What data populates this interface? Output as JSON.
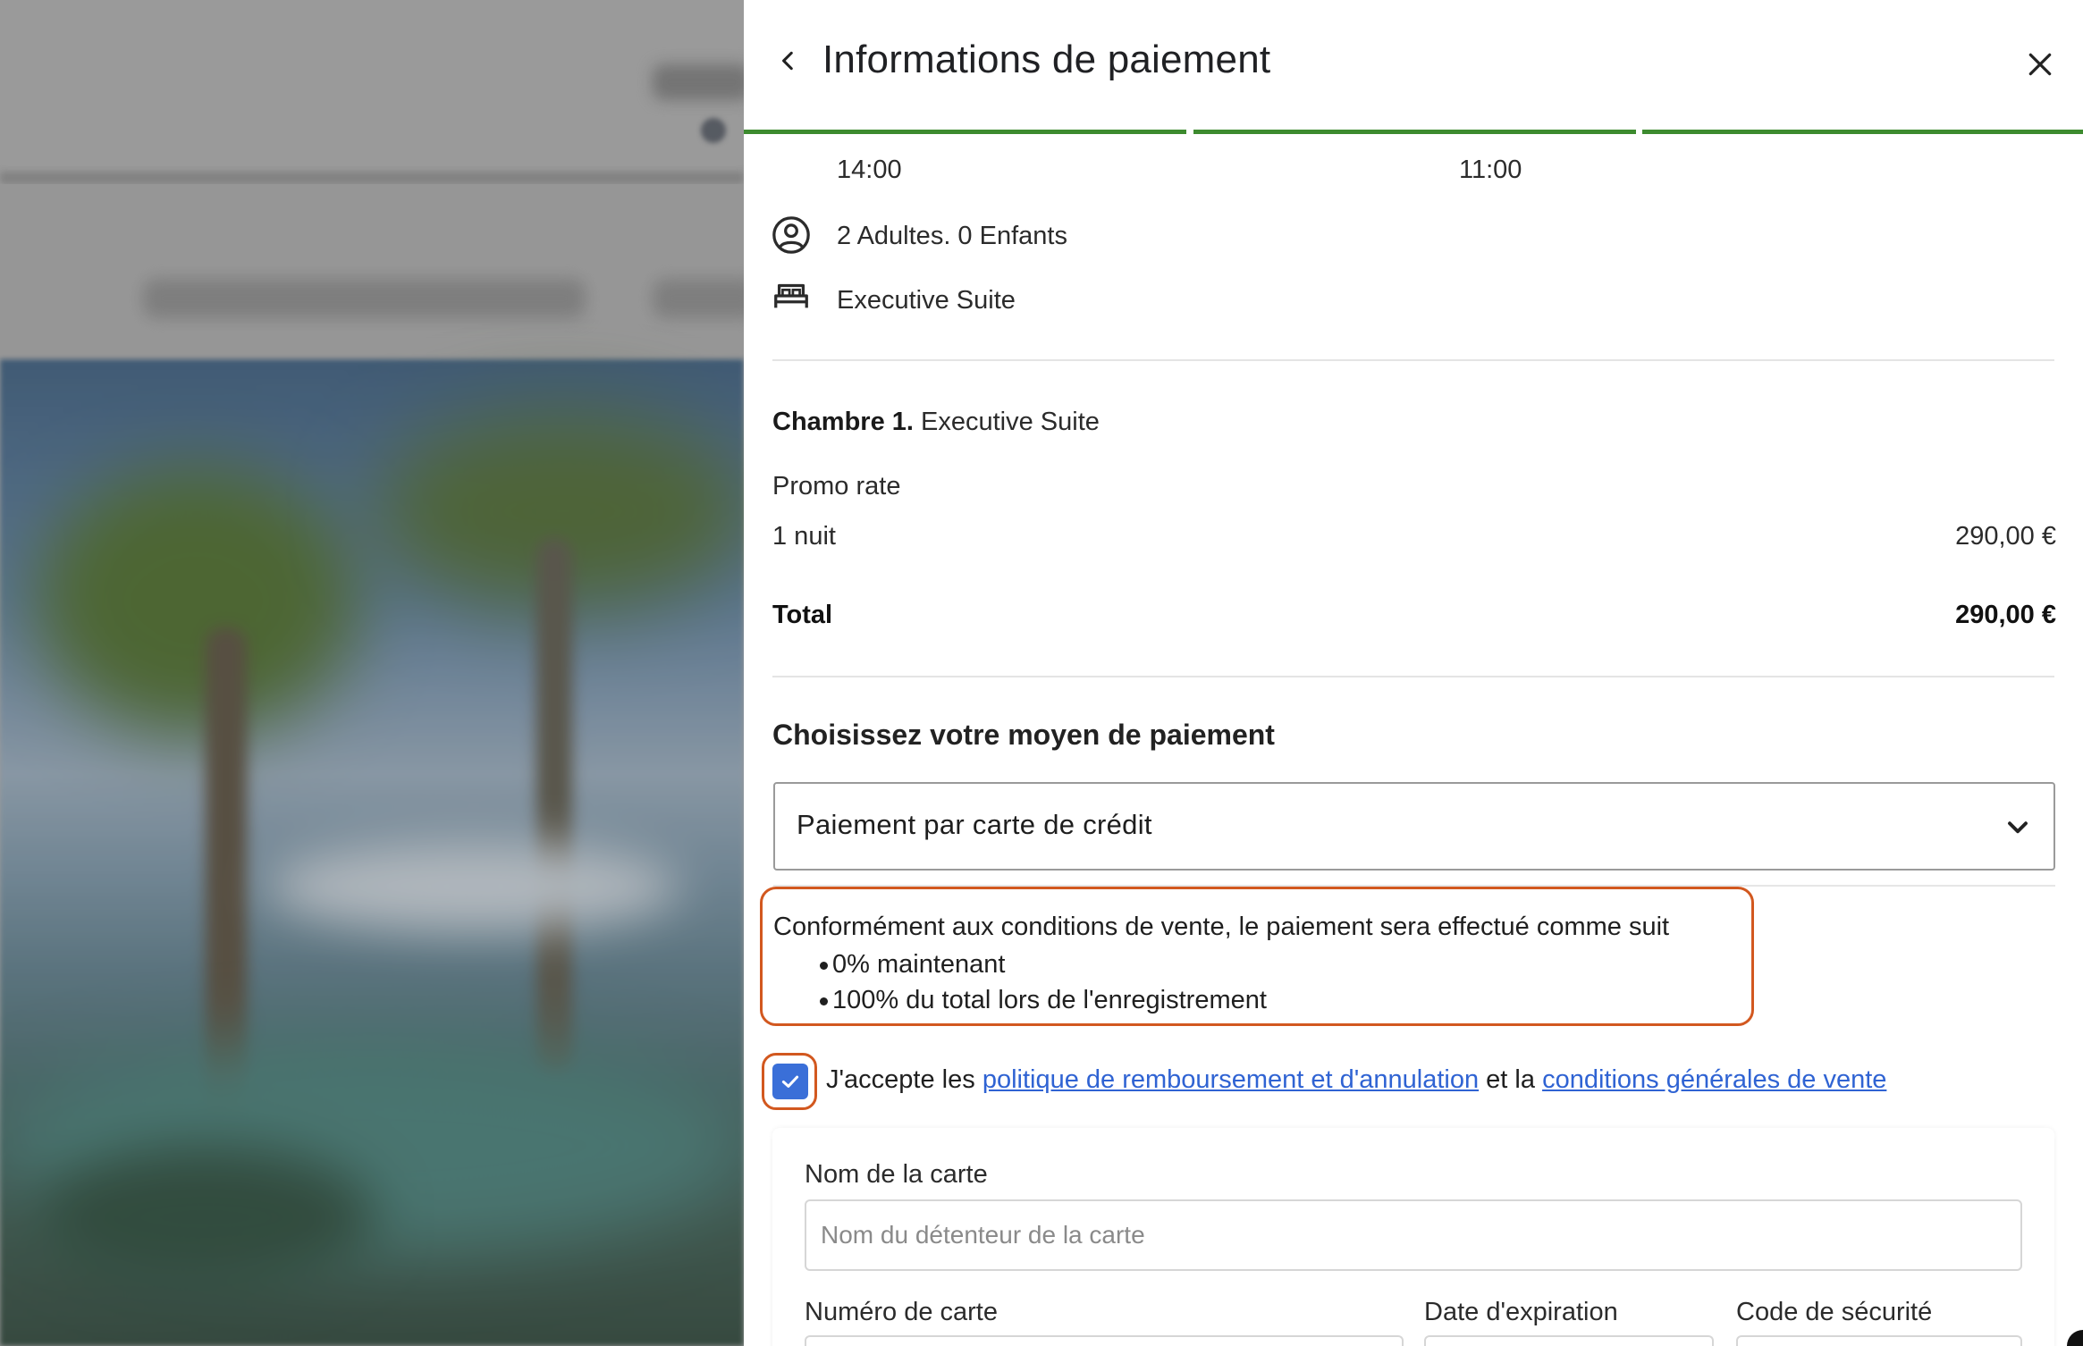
{
  "panel": {
    "title": "Informations de paiement"
  },
  "stay": {
    "checkin_time": "14:00",
    "checkout_time": "11:00",
    "guests": "2 Adultes. 0 Enfants",
    "room_type": "Executive Suite"
  },
  "summary": {
    "room_label": "Chambre 1.",
    "room_name": "Executive Suite",
    "rate_name": "Promo rate",
    "nights_label": "1 nuit",
    "nights_amount": "290,00 €",
    "total_label": "Total",
    "total_amount": "290,00 €"
  },
  "payment": {
    "section_title": "Choisissez votre moyen de paiement",
    "selected_method": "Paiement par carte de crédit",
    "notice_lead": "Conformément aux conditions de vente, le paiement sera effectué comme suit",
    "notice_items": [
      "0% maintenant",
      "100% du total lors de l'enregistrement"
    ],
    "consent_checked": true,
    "consent_prefix": "J'accepte les",
    "consent_link_1": "politique de remboursement et d'annulation",
    "consent_middle": "et la",
    "consent_link_2": "conditions générales de vente"
  },
  "card_form": {
    "name_label": "Nom de la carte",
    "name_placeholder": "Nom du détenteur de la carte",
    "number_label": "Numéro de carte",
    "expiry_label": "Date d'expiration",
    "cvc_label": "Code de sécurité"
  },
  "colors": {
    "accent_green": "#3d8b2f",
    "highlight_orange": "#d2581f",
    "link_blue": "#2f63d3",
    "checkbox_blue": "#3a6fd8"
  },
  "icons": [
    "chevron-left-icon",
    "close-icon",
    "user-circle-icon",
    "bed-icon",
    "chevron-down-icon",
    "check-icon"
  ]
}
